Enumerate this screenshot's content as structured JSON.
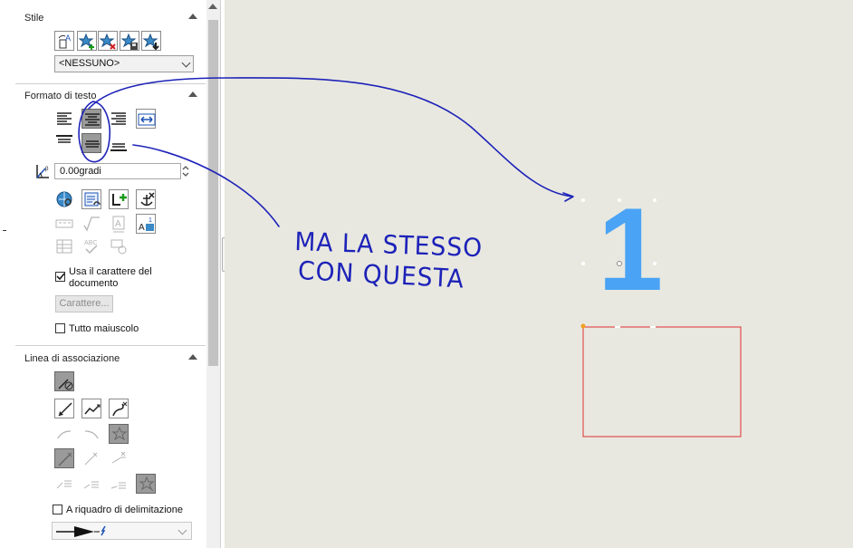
{
  "style_section": {
    "title": "Stile",
    "icons": [
      "style-apply-icon",
      "style-add-icon",
      "style-delete-icon",
      "style-save-icon",
      "style-load-icon"
    ],
    "dropdown_value": "<NESSUNO>"
  },
  "text_format_section": {
    "title": "Formato di testo",
    "align_buttons": [
      "align-left-icon",
      "align-center-icon",
      "align-right-icon",
      "fit-text-icon"
    ],
    "valign_buttons": [
      "align-top-icon",
      "align-middle-icon",
      "align-bottom-icon"
    ],
    "angle_value": "0.00gradi",
    "use_doc_font_label_line1": "Usa il carattere del",
    "use_doc_font_label_line2": "documento",
    "font_button_label": "Carattere...",
    "all_caps_label": "Tutto maiuscolo"
  },
  "leader_section": {
    "title": "Linea di associazione",
    "frame_label": "A riquadro di delimitazione"
  },
  "annotation": {
    "handwritten_line1": "MA LA STESSO",
    "handwritten_line2": "CON QUESTA",
    "ink_color": "#1d22b8"
  },
  "canvas": {
    "note_text": "1",
    "note_color": "#4aa3f5",
    "box_color": "#e03030"
  }
}
